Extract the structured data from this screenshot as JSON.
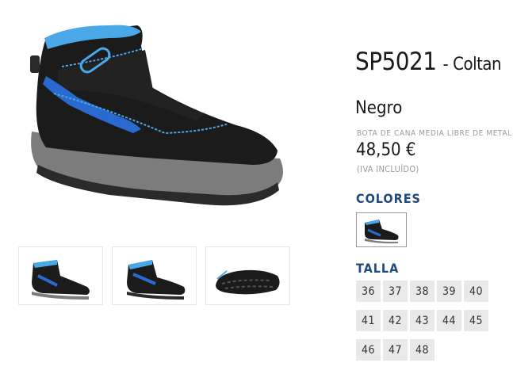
{
  "product": {
    "code": "SP5021",
    "separator": "-",
    "model": "Coltan",
    "color_name": "Negro",
    "description": "BOTA DE CANA MEDIA LIBRE DE METAL...",
    "price": "48,50 €",
    "tax_note": "(IVA INCLUÍDO)"
  },
  "colors": {
    "label": "COLORES",
    "options": [
      {
        "icon": "boot-thumbnail"
      }
    ]
  },
  "sizes": {
    "label": "TALLA",
    "rows": [
      [
        "36",
        "37",
        "38",
        "39",
        "40"
      ],
      [
        "41",
        "42",
        "43",
        "44",
        "45"
      ],
      [
        "46",
        "47",
        "48"
      ]
    ]
  },
  "gallery": {
    "thumbnails": [
      {
        "icon": "boot-side-view"
      },
      {
        "icon": "boot-three-quarter-view"
      },
      {
        "icon": "boot-sole-view"
      }
    ]
  },
  "accent_colors": {
    "label_blue": "#1f4a80",
    "boot_black": "#1b1b1b",
    "boot_blue": "#2a6ad0",
    "stitch_blue": "#4aa8e8",
    "sole_grey": "#7c7c7c"
  }
}
